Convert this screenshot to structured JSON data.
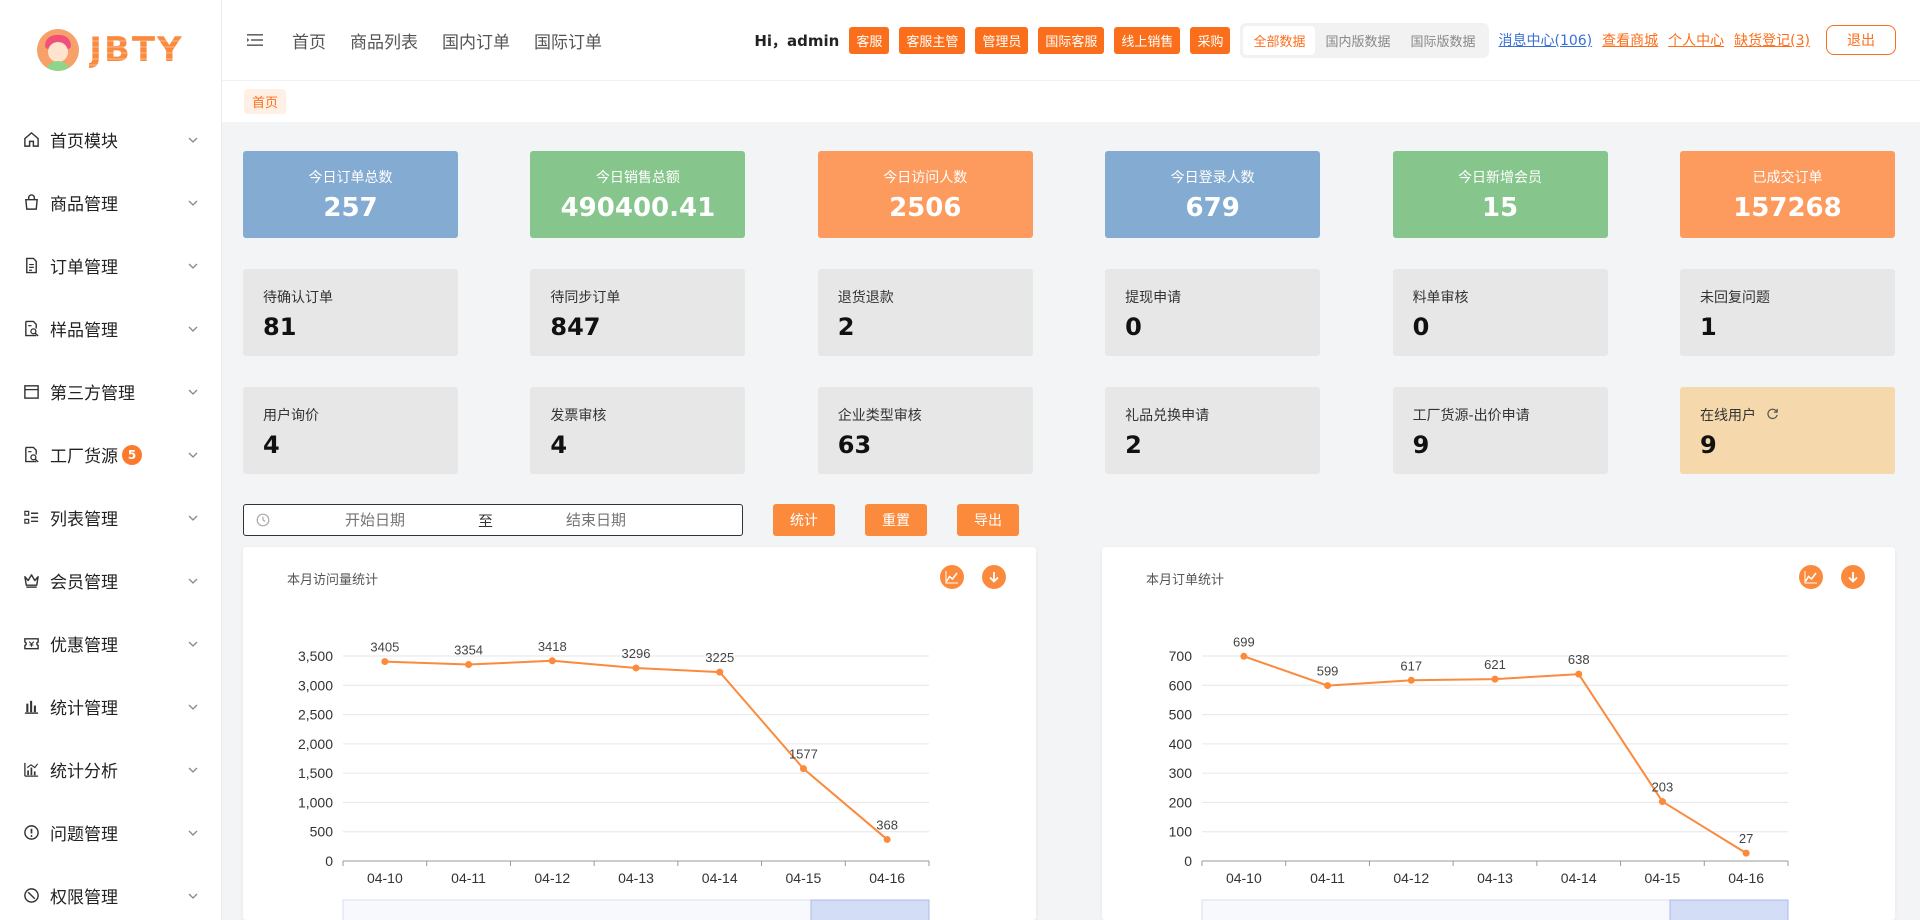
{
  "brand": {
    "name": "JBTY"
  },
  "sidebar": {
    "items": [
      {
        "label": "首页模块",
        "icon": "home-icon"
      },
      {
        "label": "商品管理",
        "icon": "shopping-bag-icon"
      },
      {
        "label": "订单管理",
        "icon": "document-icon"
      },
      {
        "label": "样品管理",
        "icon": "document-search-icon"
      },
      {
        "label": "第三方管理",
        "icon": "calendar-icon"
      },
      {
        "label": "工厂货源",
        "icon": "document-search-icon",
        "badge": "5"
      },
      {
        "label": "列表管理",
        "icon": "list-icon"
      },
      {
        "label": "会员管理",
        "icon": "crown-icon"
      },
      {
        "label": "优惠管理",
        "icon": "ticket-icon"
      },
      {
        "label": "统计管理",
        "icon": "bar-chart-icon"
      },
      {
        "label": "统计分析",
        "icon": "analytics-icon"
      },
      {
        "label": "问题管理",
        "icon": "alert-circle-icon"
      },
      {
        "label": "权限管理",
        "icon": "lock-icon"
      }
    ]
  },
  "header": {
    "nav": [
      "首页",
      "商品列表",
      "国内订单",
      "国际订单"
    ],
    "greeting": "Hi，admin",
    "roles": [
      "客服",
      "客服主管",
      "管理员",
      "国际客服",
      "线上销售",
      "采购"
    ],
    "data_tabs": [
      "全部数据",
      "国内版数据",
      "国际版数据"
    ],
    "active_data_tab": "全部数据",
    "links": {
      "messages": "消息中心(106)",
      "mall": "查看商城",
      "profile": "个人中心",
      "shortage": "缺货登记(3)"
    },
    "logout": "退出"
  },
  "breadcrumb": "首页",
  "stats_primary": [
    {
      "label": "今日订单总数",
      "value": "257",
      "color": "blue"
    },
    {
      "label": "今日销售总额",
      "value": "490400.41",
      "color": "green"
    },
    {
      "label": "今日访问人数",
      "value": "2506",
      "color": "orange"
    },
    {
      "label": "今日登录人数",
      "value": "679",
      "color": "blue"
    },
    {
      "label": "今日新增会员",
      "value": "15",
      "color": "green"
    },
    {
      "label": "已成交订单",
      "value": "157268",
      "color": "orange"
    }
  ],
  "stats_pending": [
    {
      "label": "待确认订单",
      "value": "81"
    },
    {
      "label": "待同步订单",
      "value": "847"
    },
    {
      "label": "退货退款",
      "value": "2"
    },
    {
      "label": "提现申请",
      "value": "0"
    },
    {
      "label": "料单审核",
      "value": "0"
    },
    {
      "label": "未回复问题",
      "value": "1"
    }
  ],
  "stats_review": [
    {
      "label": "用户询价",
      "value": "4"
    },
    {
      "label": "发票审核",
      "value": "4"
    },
    {
      "label": "企业类型审核",
      "value": "63"
    },
    {
      "label": "礼品兑换申请",
      "value": "2"
    },
    {
      "label": "工厂货源-出价申请",
      "value": "9"
    },
    {
      "label": "在线用户",
      "value": "9",
      "highlight": true
    }
  ],
  "filter": {
    "start_placeholder": "开始日期",
    "separator": "至",
    "end_placeholder": "结束日期",
    "buttons": [
      "统计",
      "重置",
      "导出"
    ]
  },
  "colors": {
    "accent": "#fb6f1c",
    "line": "#fb8a3c",
    "card_blue": "#84abd1",
    "card_green": "#86c68c",
    "card_orange": "#fd9b5f",
    "card_grey": "#e7e7e7",
    "card_peach": "#f5d8ac"
  },
  "chart_data": [
    {
      "type": "line",
      "title": "本月访问量统计",
      "x": [
        "04-10",
        "04-11",
        "04-12",
        "04-13",
        "04-14",
        "04-15",
        "04-16"
      ],
      "values": [
        3405,
        3354,
        3418,
        3296,
        3225,
        1577,
        368
      ],
      "yticks": [
        "0",
        "500",
        "1,000",
        "1,500",
        "2,000",
        "2,500",
        "3,000",
        "3,500"
      ],
      "ylim": [
        0,
        3500
      ],
      "data_labels": true,
      "grid": true
    },
    {
      "type": "line",
      "title": "本月订单统计",
      "x": [
        "04-10",
        "04-11",
        "04-12",
        "04-13",
        "04-14",
        "04-15",
        "04-16"
      ],
      "values": [
        699,
        599,
        617,
        621,
        638,
        203,
        27
      ],
      "yticks": [
        "0",
        "100",
        "200",
        "300",
        "400",
        "500",
        "600",
        "700"
      ],
      "ylim": [
        0,
        700
      ],
      "data_labels": true,
      "grid": true
    }
  ]
}
